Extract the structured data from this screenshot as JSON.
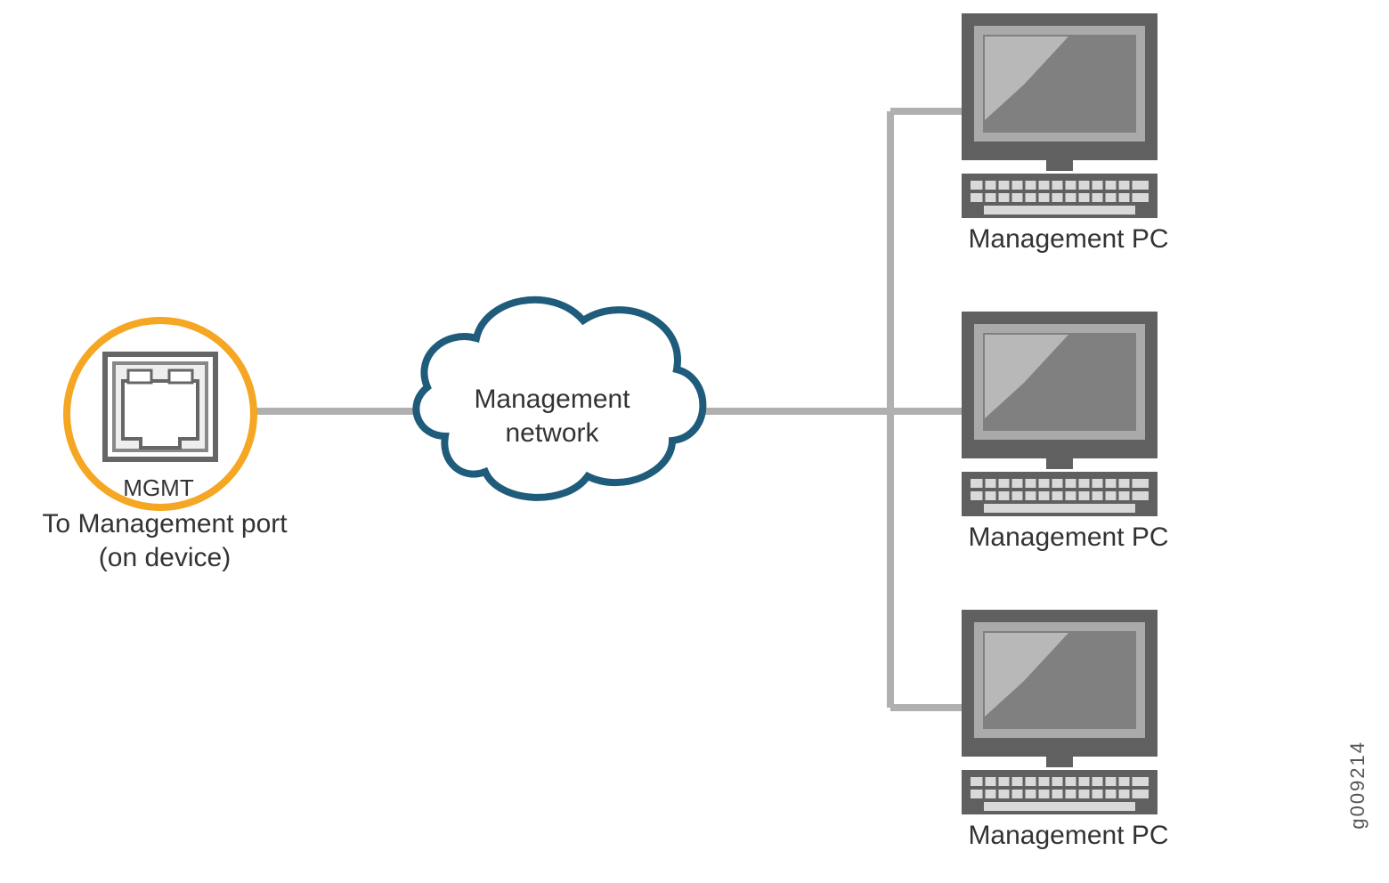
{
  "port": {
    "code": "MGMT",
    "caption_line1": "To Management port",
    "caption_line2": "(on device)"
  },
  "cloud": {
    "line1": "Management",
    "line2": "network"
  },
  "pcs": [
    {
      "label": "Management PC"
    },
    {
      "label": "Management PC"
    },
    {
      "label": "Management PC"
    }
  ],
  "figure_number": "g009214"
}
